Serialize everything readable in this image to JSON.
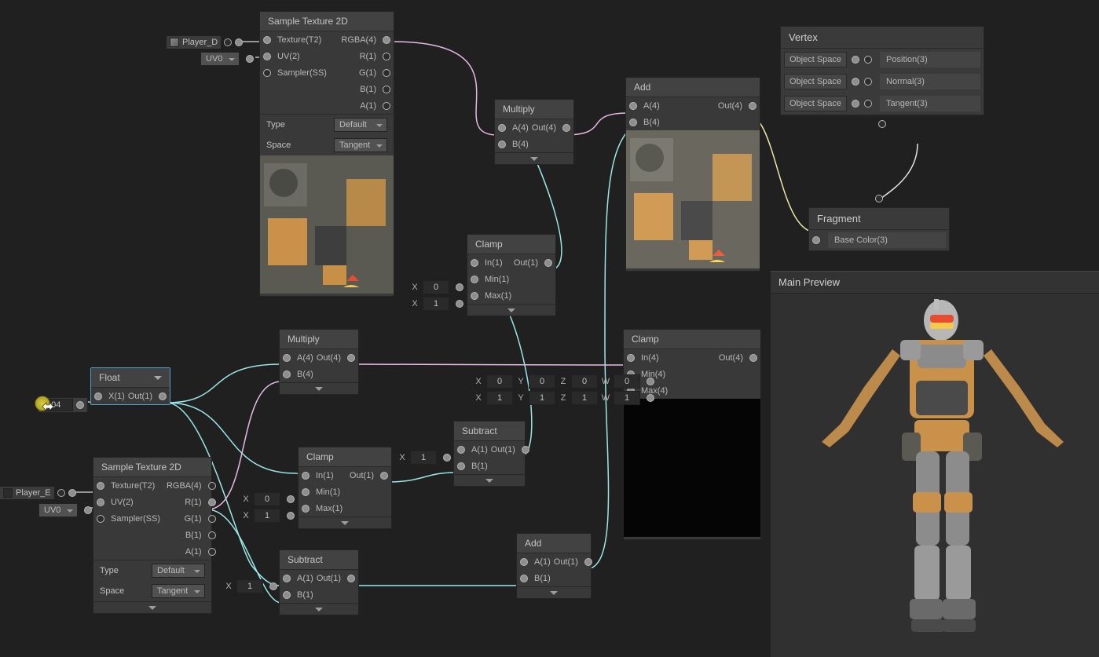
{
  "nodes": {
    "sampleTex1": {
      "title": "Sample Texture 2D",
      "in": [
        "Texture(T2)",
        "UV(2)",
        "Sampler(SS)"
      ],
      "out": [
        "RGBA(4)",
        "R(1)",
        "G(1)",
        "B(1)",
        "A(1)"
      ],
      "typeLabel": "Type",
      "typeVal": "Default",
      "spaceLabel": "Space",
      "spaceVal": "Tangent"
    },
    "sampleTex2": {
      "title": "Sample Texture 2D",
      "in": [
        "Texture(T2)",
        "UV(2)",
        "Sampler(SS)"
      ],
      "out": [
        "RGBA(4)",
        "R(1)",
        "G(1)",
        "B(1)",
        "A(1)"
      ],
      "typeLabel": "Type",
      "typeVal": "Default",
      "spaceLabel": "Space",
      "spaceVal": "Tangent"
    },
    "multiply1": {
      "title": "Multiply",
      "in": [
        "A(4)",
        "B(4)"
      ],
      "out": [
        "Out(4)"
      ]
    },
    "multiply2": {
      "title": "Multiply",
      "in": [
        "A(4)",
        "B(4)"
      ],
      "out": [
        "Out(4)"
      ]
    },
    "add1": {
      "title": "Add",
      "in": [
        "A(4)",
        "B(4)"
      ],
      "out": [
        "Out(4)"
      ]
    },
    "add2": {
      "title": "Add",
      "in": [
        "A(1)",
        "B(1)"
      ],
      "out": [
        "Out(1)"
      ]
    },
    "clamp1": {
      "title": "Clamp",
      "in": [
        "In(1)",
        "Min(1)",
        "Max(1)"
      ],
      "out": [
        "Out(1)"
      ]
    },
    "clamp2": {
      "title": "Clamp",
      "in": [
        "In(1)",
        "Min(1)",
        "Max(1)"
      ],
      "out": [
        "Out(1)"
      ]
    },
    "clamp3": {
      "title": "Clamp",
      "in": [
        "In(4)",
        "Min(4)",
        "Max(4)"
      ],
      "out": [
        "Out(4)"
      ]
    },
    "subtract1": {
      "title": "Subtract",
      "in": [
        "A(1)",
        "B(1)"
      ],
      "out": [
        "Out(1)"
      ]
    },
    "subtract2": {
      "title": "Subtract",
      "in": [
        "A(1)",
        "B(1)"
      ],
      "out": [
        "Out(1)"
      ]
    },
    "floatNode": {
      "title": "Float",
      "in": [
        "X(1)"
      ],
      "out": [
        "Out(1)"
      ]
    }
  },
  "floatValue": "0.04",
  "clamp1Min": "0",
  "clamp1Max": "1",
  "clamp2X": "0",
  "clamp2X2": "1",
  "subtract1X": "1",
  "subtract2X": "1",
  "clamp3Min": {
    "X": "0",
    "Y": "0",
    "Z": "0",
    "W": "0"
  },
  "clamp3Max": {
    "X": "1",
    "Y": "1",
    "Z": "1",
    "W": "1"
  },
  "external": {
    "playerD": "Player_D",
    "playerE": "Player_E",
    "uv": "UV0"
  },
  "vertex": {
    "title": "Vertex",
    "rows": [
      [
        "Object Space",
        "Position(3)"
      ],
      [
        "Object Space",
        "Normal(3)"
      ],
      [
        "Object Space",
        "Tangent(3)"
      ]
    ]
  },
  "fragment": {
    "title": "Fragment",
    "rows": [
      [
        "",
        "Base Color(3)"
      ]
    ]
  },
  "previewTitle": "Main Preview",
  "labels": {
    "X": "X",
    "Y": "Y",
    "Z": "Z",
    "W": "W"
  }
}
